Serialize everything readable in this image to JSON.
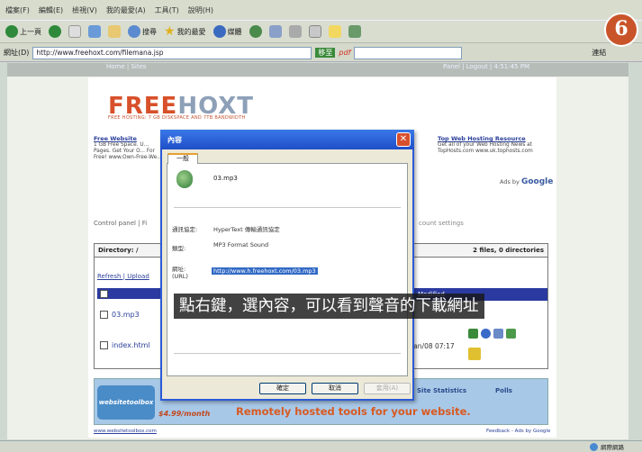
{
  "browser": {
    "menu": [
      "檔案(F)",
      "編輯(E)",
      "檢視(V)",
      "我的最愛(A)",
      "工具(T)",
      "說明(H)"
    ],
    "toolbar": {
      "back": "上一頁",
      "search": "搜尋",
      "favorites": "我的最愛",
      "media": "媒體"
    },
    "address_label": "網址(D)",
    "url": "http://www.freehoxt.com/filemana.jsp",
    "go_label": "移至",
    "pdf_label": "pdf",
    "links": "連結"
  },
  "page": {
    "topstrip_left": "Home | Sites",
    "topstrip_right": "Panel | Logout | 4:51:45 PM",
    "logo_a": "FREE",
    "logo_b": "HOXT",
    "tagline": "FREE HOSTING: 7 GB DISKSPACE AND 7TB BANDWIDTH",
    "ad_left": {
      "title": "Free Website",
      "text": "1 GB Free Space. U... Pages. Get Your O... For Free! www.Own-Free-We..."
    },
    "ad_right": {
      "title": "Top Web Hosting Resource",
      "text": "Get all of your Web Hosting News at TopHosts.com www.uk.tophosts.com"
    },
    "ads_by": "Ads by",
    "google": "Google",
    "cpanel": "Control panel | Fi",
    "cpanel_right": "count settings",
    "directory": "Directory: /",
    "dir_count": "2 files, 0 directories",
    "actions": "Refresh | Upload",
    "col_modified": "Modified",
    "files": [
      {
        "name": "03.mp3",
        "date": ""
      },
      {
        "name": "index.html",
        "date": "Jan/08 07:17"
      }
    ]
  },
  "banner": {
    "logo": "websitetoolbox",
    "price": "$4.99/month",
    "headline": "Remotely hosted tools for your website.",
    "site_stats": "Site Statistics",
    "polls": "Polls",
    "footer_left": "www.websitetoolbox.com",
    "footer_right": "Feedback - Ads by Google"
  },
  "dialog": {
    "title": "內容",
    "tab": "一般",
    "filename": "03.mp3",
    "protocol_label": "通訊協定:",
    "protocol_value": "HyperText 傳輸通訊協定",
    "type_label": "類型:",
    "type_value": "MP3 Format Sound",
    "address_label": "網址:\n(URL)",
    "address_value": "http://www.h.freehoxt.com/03.mp3",
    "ok": "確定",
    "cancel": "取消",
    "apply": "套用(A)"
  },
  "caption": "點右鍵，選內容，可以看到聲音的下載網址",
  "badge": "6",
  "status": "網際網路"
}
